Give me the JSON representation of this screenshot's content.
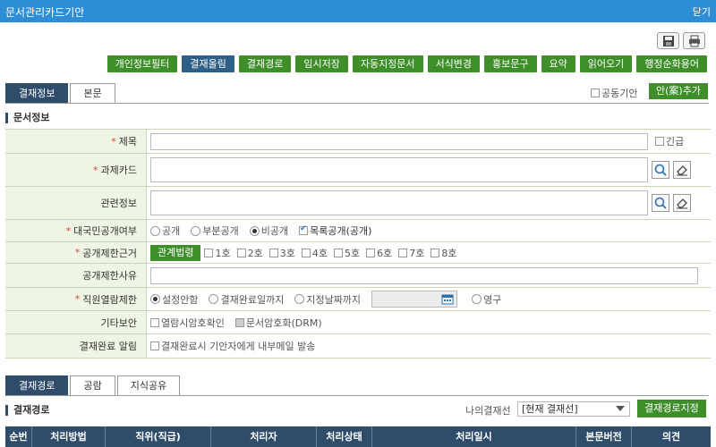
{
  "window": {
    "title": "문서관리카드기안",
    "close_label": "닫기"
  },
  "toolbar": {
    "buttons": [
      "개인정보필터",
      "결재올림",
      "결재경로",
      "임시저장",
      "자동지정문서",
      "서식변경",
      "홍보문구",
      "요약",
      "읽어오기",
      "행정순화용어"
    ],
    "primary_index": 1
  },
  "tabs_top": {
    "items": [
      "결재정보",
      "본문"
    ],
    "active": 0
  },
  "joint_draft_label": "공동기안",
  "add_plan_label": "안(案)추가",
  "doc_info_title": "문서정보",
  "form": {
    "title_label": "제목",
    "urgent_label": "긴급",
    "task_card_label": "과제카드",
    "related_info_label": "관련정보",
    "public_label": "대국민공개여부",
    "public_options": [
      "공개",
      "부분공개",
      "비공개"
    ],
    "public_selected": 2,
    "list_public_label": "목록공개(공개)",
    "restrict_basis_label": "공개제한근거",
    "law_button_label": "관계법령",
    "clauses": [
      "1호",
      "2호",
      "3호",
      "4호",
      "5호",
      "6호",
      "7호",
      "8호"
    ],
    "restrict_reason_label": "공개제한사유",
    "staff_restrict_label": "직원열람제한",
    "staff_options": [
      "설정안함",
      "결재완료일까지",
      "지정날짜까지"
    ],
    "staff_permanent": "영구",
    "etc_security_label": "기타보안",
    "read_password_label": "열람시암호확인",
    "doc_encrypt_label": "문서암호화(DRM)",
    "approval_alert_label": "결재완료 알림",
    "approval_alert_option": "결재완료시 기안자에게 내부메일 발송"
  },
  "tabs_bottom": {
    "items": [
      "결재경로",
      "공람",
      "지식공유"
    ],
    "active": 0
  },
  "approval_route_title": "결재경로",
  "my_line_label": "나의결재선",
  "my_line_value": "[현재 결재선]",
  "designate_route_label": "결재경로지정",
  "table_headers": [
    "순번",
    "처리방법",
    "직위(직급)",
    "처리자",
    "처리상태",
    "처리일시",
    "본문버전",
    "의견"
  ],
  "icons": [
    "save-icon",
    "print-icon",
    "search-icon",
    "eraser-icon",
    "calendar-icon"
  ],
  "colors": {
    "titlebar": "#2d8ed6",
    "green_button": "#3e8e2a",
    "navy": "#2f4c6a",
    "label_bg": "#eef5e4"
  }
}
